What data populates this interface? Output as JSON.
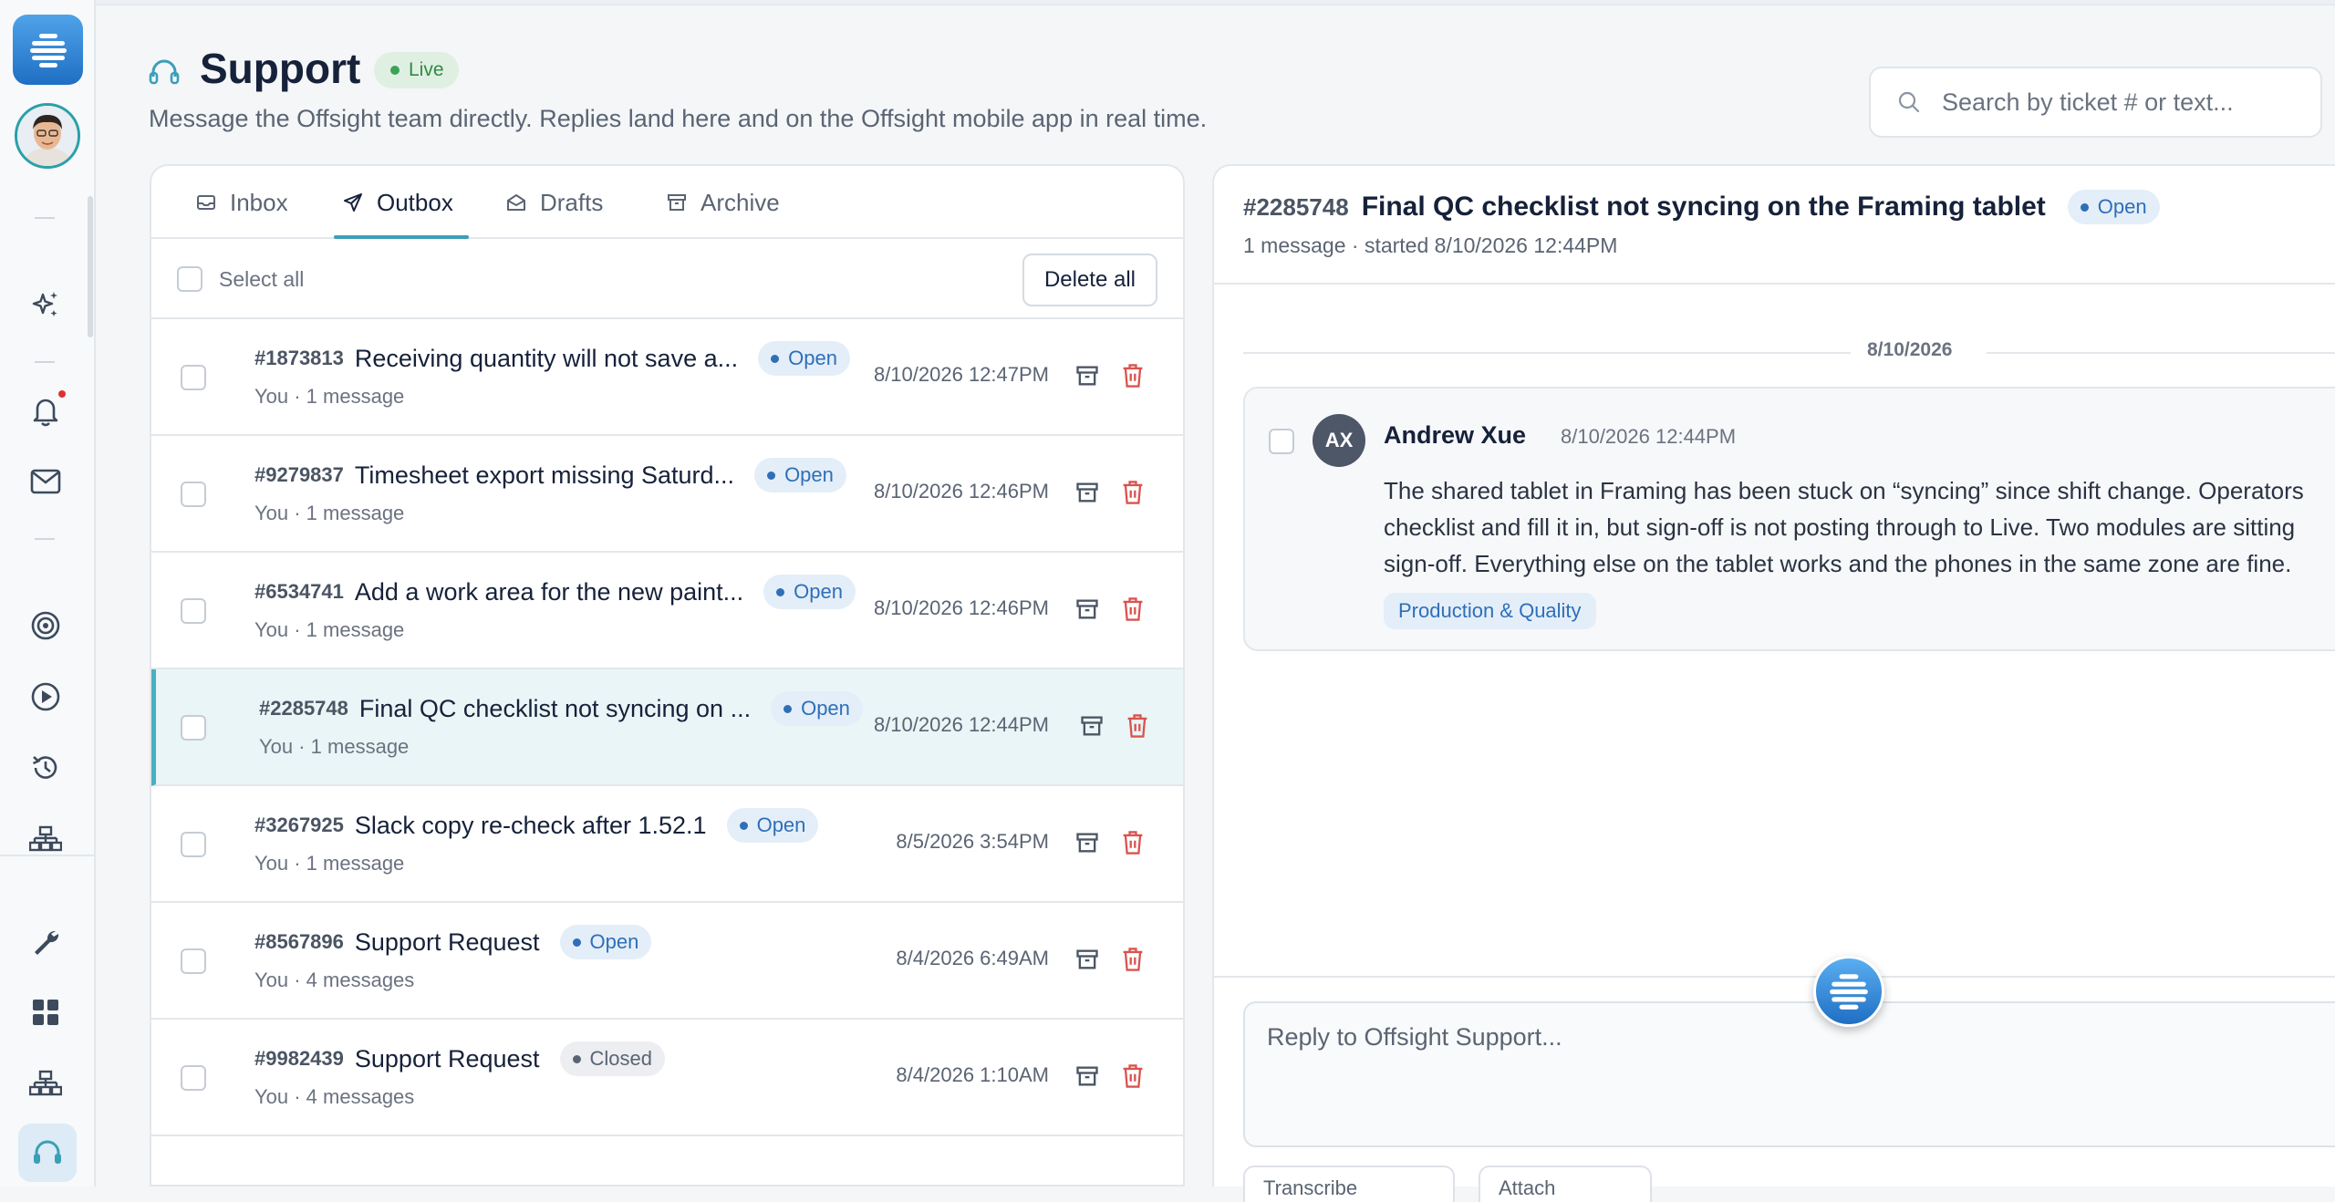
{
  "header": {
    "title": "Support",
    "live_badge": "Live",
    "subtitle": "Message the Offsight team directly. Replies land here and on the Offsight mobile app in real time."
  },
  "search": {
    "placeholder": "Search by ticket # or text..."
  },
  "tabs": [
    {
      "label": "Inbox",
      "icon": "inbox-icon",
      "active": false
    },
    {
      "label": "Outbox",
      "icon": "send-icon",
      "active": true
    },
    {
      "label": "Drafts",
      "icon": "drafts-icon",
      "active": false
    },
    {
      "label": "Archive",
      "icon": "archive-icon",
      "active": false
    }
  ],
  "list": {
    "select_all": "Select all",
    "delete_all": "Delete all",
    "rows": [
      {
        "num": "#1873813",
        "title": "Receiving quantity will not save a...",
        "status": "Open",
        "sub": "You · 1 message",
        "date": "8/10/2026 12:47PM",
        "selected": false
      },
      {
        "num": "#9279837",
        "title": "Timesheet export missing Saturd...",
        "status": "Open",
        "sub": "You · 1 message",
        "date": "8/10/2026 12:46PM",
        "selected": false
      },
      {
        "num": "#6534741",
        "title": "Add a work area for the new paint...",
        "status": "Open",
        "sub": "You · 1 message",
        "date": "8/10/2026 12:46PM",
        "selected": false
      },
      {
        "num": "#2285748",
        "title": "Final QC checklist not syncing on ...",
        "status": "Open",
        "sub": "You · 1 message",
        "date": "8/10/2026 12:44PM",
        "selected": true
      },
      {
        "num": "#3267925",
        "title": "Slack copy re-check after 1.52.1",
        "status": "Open",
        "sub": "You · 1 message",
        "date": "8/5/2026 3:54PM",
        "selected": false
      },
      {
        "num": "#8567896",
        "title": "Support Request",
        "status": "Open",
        "sub": "You · 4 messages",
        "date": "8/4/2026 6:49AM",
        "selected": false
      },
      {
        "num": "#9982439",
        "title": "Support Request",
        "status": "Closed",
        "sub": "You · 4 messages",
        "date": "8/4/2026 1:10AM",
        "selected": false
      }
    ]
  },
  "thread": {
    "num": "#2285748",
    "title": "Final QC checklist not syncing on the Framing tablet",
    "status": "Open",
    "meta": "1 message · started 8/10/2026 12:44PM",
    "date_divider": "8/10/2026",
    "message": {
      "initials": "AX",
      "author": "Andrew Xue",
      "time": "8/10/2026 12:44PM",
      "body_lines": [
        "The shared tablet in Framing has been stuck on “syncing” since shift change. Operators",
        "checklist and fill it in, but sign-off is not posting through to Live. Two modules are sitting",
        "sign-off. Everything else on the tablet works and the phones in the same zone are fine."
      ],
      "tag": "Production & Quality"
    },
    "reply_placeholder": "Reply to Offsight Support...",
    "tool_buttons": [
      "Transcribe",
      "Attach"
    ]
  },
  "colors": {
    "accent": "#3b9fb8",
    "open_pill": "#2e6fb8",
    "live_green": "#2f8a45",
    "delete_red": "#d9534f"
  }
}
